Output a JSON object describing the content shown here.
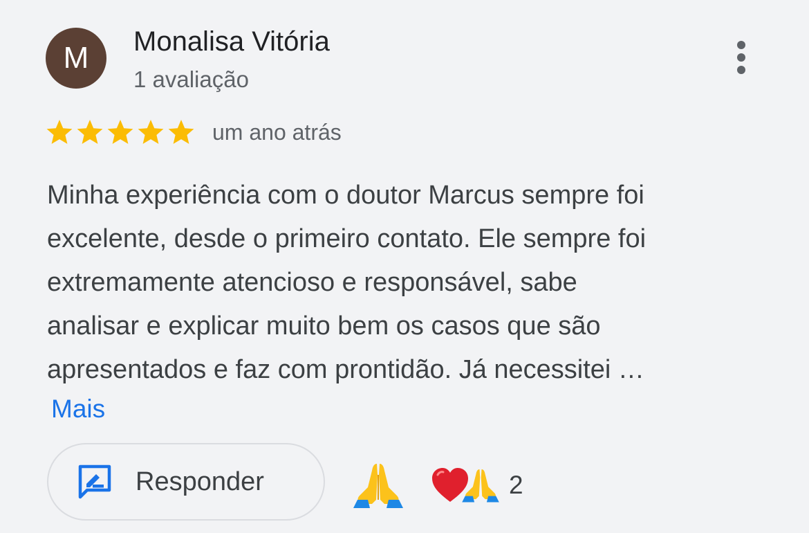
{
  "review": {
    "author": {
      "initial": "M",
      "name": "Monalisa Vitória",
      "review_count": "1 avaliação",
      "avatar_color": "#5b4034"
    },
    "menu_icon": "more-vert-icon",
    "rating": {
      "stars": 5,
      "max_stars": 5,
      "star_color": "#fbbc04",
      "time_ago": "um ano atrás"
    },
    "body_lines": [
      "Minha experiência com o doutor Marcus sempre foi",
      "excelente, desde o primeiro contato. Ele sempre foi",
      "extremamente atencioso e responsável, sabe",
      "analisar e explicar muito bem os casos que são",
      "apresentados e faz com prontidão. Já necessitei …"
    ],
    "more_label": "Mais",
    "more_color": "#1a73e8",
    "actions": {
      "reply_label": "Responder",
      "reply_icon": "rate-review-icon",
      "reaction_icon": "folded-hands-icon",
      "reactions": [
        "heart-icon",
        "folded-hands-icon"
      ],
      "reaction_count": "2"
    }
  }
}
